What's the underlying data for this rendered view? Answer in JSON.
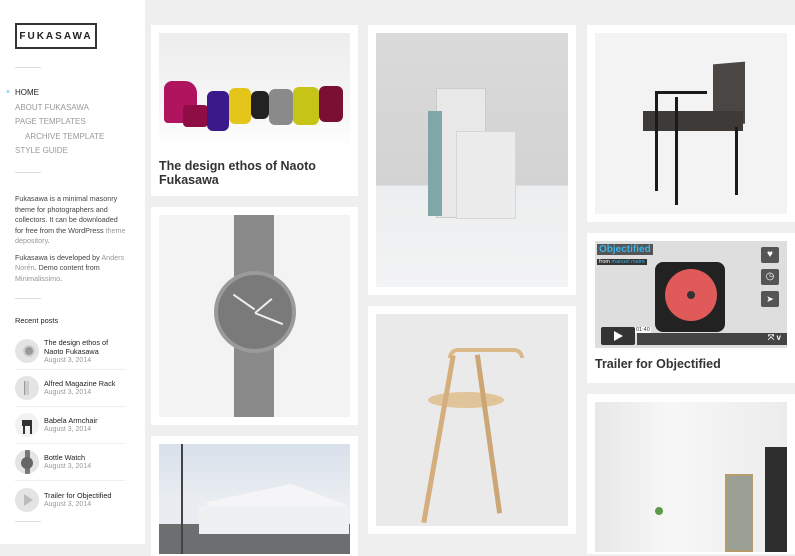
{
  "site": {
    "logo": "FUKASAWA"
  },
  "nav": [
    {
      "label": "HOME",
      "active": true,
      "marker": "×"
    },
    {
      "label": "ABOUT FUKASAWA"
    },
    {
      "label": "PAGE TEMPLATES"
    },
    {
      "label": "ARCHIVE TEMPLATE",
      "sub": true
    },
    {
      "label": "STYLE GUIDE"
    }
  ],
  "about": {
    "p1_a": "Fukasawa is a minimal masonry theme for photographers and collectors. It can be downloaded for free from the WordPress ",
    "p1_link": "theme depository",
    "p1_b": ".",
    "p2_a": "Fukasawa is developed by ",
    "p2_link1": "Anders Norén",
    "p2_b": ". Demo content from ",
    "p2_link2": "Minimalissimo",
    "p2_c": "."
  },
  "recent": {
    "title": "Recent posts",
    "posts": [
      {
        "title": "The design ethos of Naoto Fukasawa",
        "date": "August 3, 2014",
        "thumb": "watch-thumb"
      },
      {
        "title": "Alfred Magazine Rack",
        "date": "August 3, 2014",
        "thumb": "rack-thumb"
      },
      {
        "title": "Babela Armchair",
        "date": "August 3, 2014",
        "thumb": "chair-thumb"
      },
      {
        "title": "Bottle Watch",
        "date": "August 3, 2014",
        "thumb": "watch-thumb"
      },
      {
        "title": "Trailer for Objectified",
        "date": "August 3, 2014",
        "thumb": "play-thumb"
      }
    ]
  },
  "posts": [
    {
      "title": "The design ethos of Naoto Fukasawa",
      "image": "colorful-armchairs-photo"
    },
    {
      "title": "",
      "image": "magazine-rack-photo"
    },
    {
      "title": "",
      "image": "armchair-photo"
    },
    {
      "title": "",
      "image": "bottle-watch-photo"
    },
    {
      "title": "Trailer for Objectified",
      "image": "video-player",
      "video": {
        "title": "Objectified",
        "from": "from",
        "author": "manuel maire",
        "time": "01:40"
      }
    },
    {
      "title": "",
      "image": "wooden-chair-photo"
    },
    {
      "title": "",
      "image": "white-house-photo"
    },
    {
      "title": "",
      "image": "interior-photo"
    }
  ],
  "colors": {
    "accent": "#3bb5e8",
    "vimeo_red": "#e05a5a"
  }
}
